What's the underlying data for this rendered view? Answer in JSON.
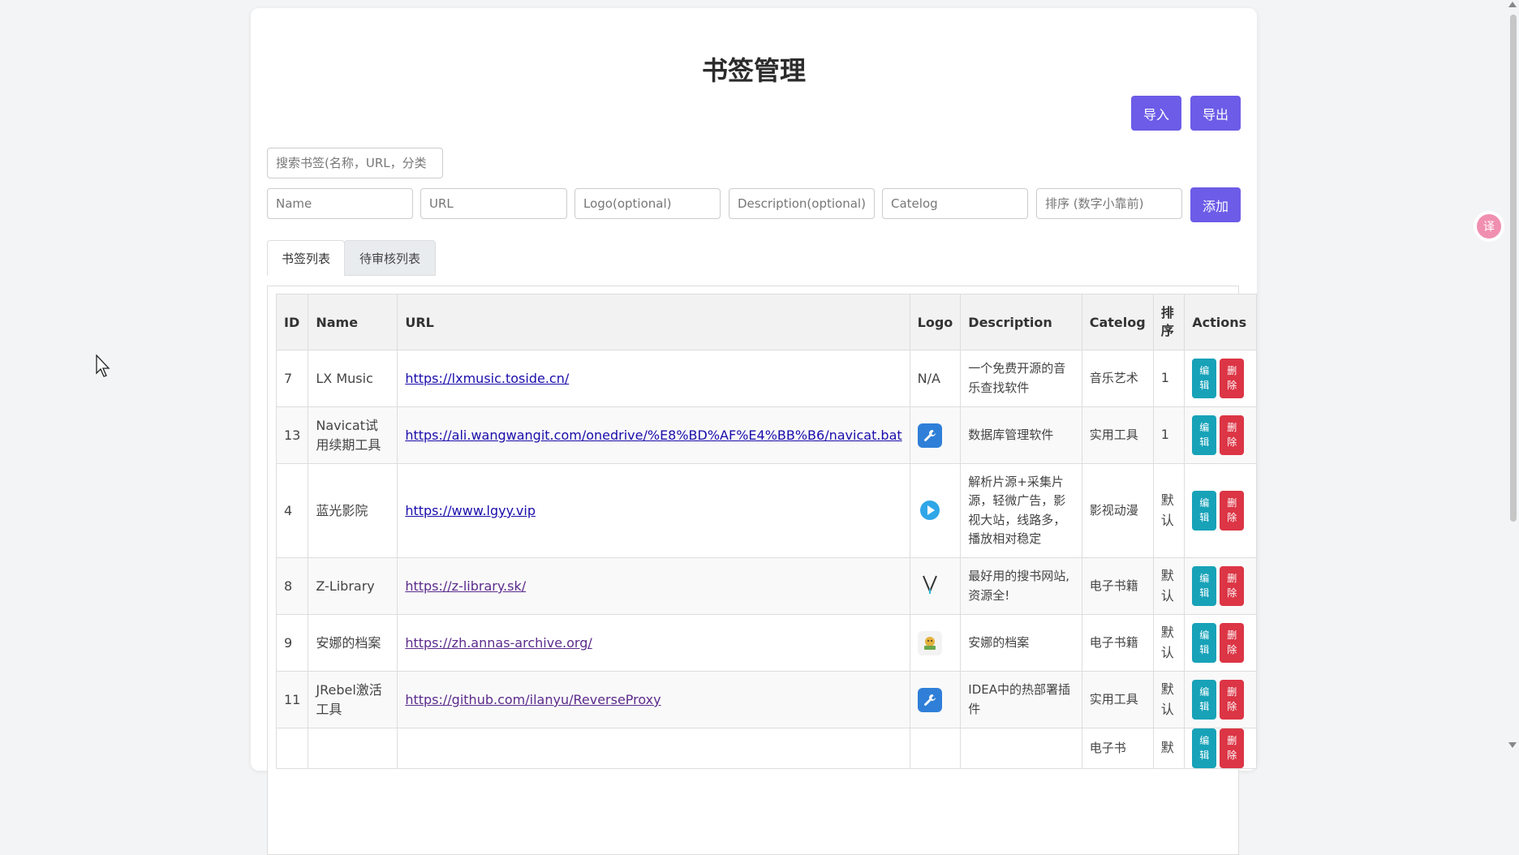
{
  "page": {
    "title": "书签管理"
  },
  "toolbar": {
    "import_label": "导入",
    "export_label": "导出"
  },
  "search": {
    "placeholder": "搜索书签(名称，URL，分类"
  },
  "form": {
    "name_placeholder": "Name",
    "url_placeholder": "URL",
    "logo_placeholder": "Logo(optional)",
    "description_placeholder": "Description(optional)",
    "catelog_placeholder": "Catelog",
    "sort_placeholder": "排序 (数字小靠前)",
    "add_label": "添加"
  },
  "tabs": [
    {
      "label": "书签列表",
      "active": true
    },
    {
      "label": "待审核列表",
      "active": false
    }
  ],
  "table": {
    "headers": [
      "ID",
      "Name",
      "URL",
      "Logo",
      "Description",
      "Catelog",
      "排序",
      "Actions"
    ],
    "edit_label": "编辑",
    "delete_label": "删除",
    "rows": [
      {
        "id": "7",
        "name": "LX Music",
        "url": "https://lxmusic.toside.cn/",
        "logo": "N/A",
        "logo_icon": "text",
        "description": "一个免费开源的音乐查找软件",
        "catelog": "音乐艺术",
        "sort": "1"
      },
      {
        "id": "13",
        "name": "Navicat试用续期工具",
        "url": "https://ali.wangwangit.com/onedrive/%E8%BD%AF%E4%BB%B6/navicat.bat",
        "logo": "",
        "logo_icon": "wrench-icon",
        "description": "数据库管理软件",
        "catelog": "实用工具",
        "sort": "1"
      },
      {
        "id": "4",
        "name": "蓝光影院",
        "url": "https://www.lgyy.vip",
        "logo": "",
        "logo_icon": "play-icon",
        "description": "解析片源+采集片源，轻微广告，影视大站，线路多，播放相对稳定",
        "catelog": "影视动漫",
        "sort": "默认"
      },
      {
        "id": "8",
        "name": "Z-Library",
        "url": "https://z-library.sk/",
        "logo": "",
        "logo_icon": "zlib-icon",
        "description": "最好用的搜书网站,资源全!",
        "catelog": "电子书籍",
        "sort": "默认"
      },
      {
        "id": "9",
        "name": "安娜的档案",
        "url": "https://zh.annas-archive.org/",
        "logo": "",
        "logo_icon": "annas-icon",
        "description": "安娜的档案",
        "catelog": "电子书籍",
        "sort": "默认"
      },
      {
        "id": "11",
        "name": "JRebel激活工具",
        "url": "https://github.com/ilanyu/ReverseProxy",
        "logo": "",
        "logo_icon": "wrench-icon",
        "description": "IDEA中的热部署插件",
        "catelog": "实用工具",
        "sort": "默认"
      },
      {
        "id": "",
        "name": "",
        "url": "",
        "logo": "",
        "logo_icon": "",
        "description": "",
        "catelog": "电子书",
        "sort": "默"
      }
    ]
  },
  "colors": {
    "primary": "#6c5ce7",
    "edit": "#17a2b8",
    "delete": "#dc3545"
  }
}
